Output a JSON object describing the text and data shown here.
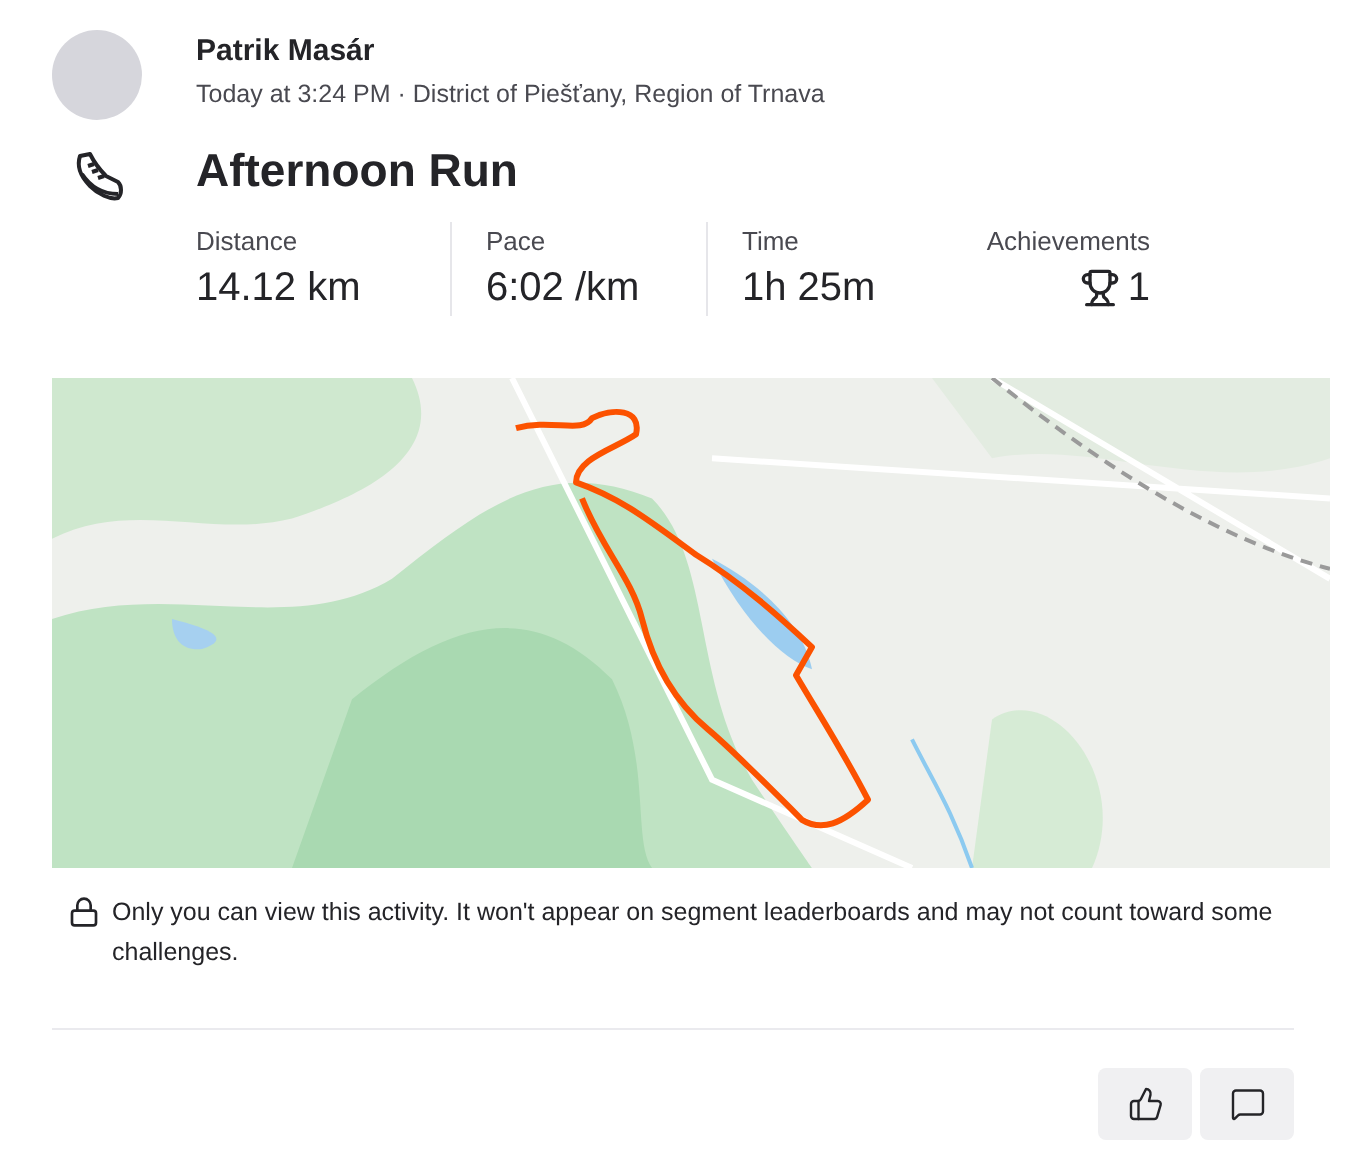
{
  "athlete": {
    "name": "Patrik Masár",
    "meta": "Today at 3:24 PM · District of Piešťany, Region of Trnava"
  },
  "activity": {
    "title": "Afternoon Run"
  },
  "stats": [
    {
      "label": "Distance",
      "value": "14.12 km"
    },
    {
      "label": "Pace",
      "value": "6:02 /km"
    },
    {
      "label": "Time",
      "value": "1h 25m"
    }
  ],
  "achievements": {
    "label": "Achievements",
    "count": "1"
  },
  "privacy_note": "Only you can view this activity. It won't appear on segment leaderboards and may not count toward some challenges."
}
